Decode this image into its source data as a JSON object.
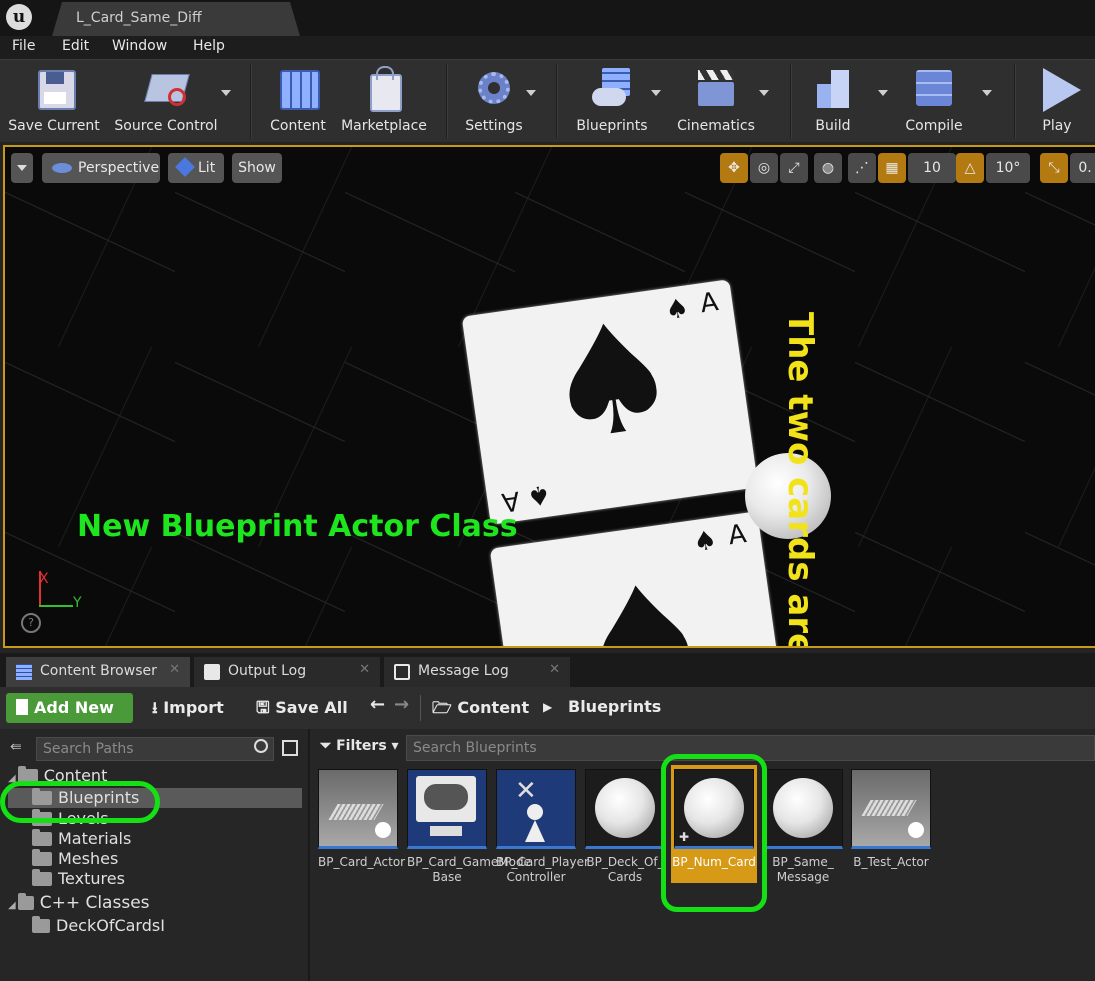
{
  "window": {
    "tab_title": "L_Card_Same_Diff",
    "logo_text": "u"
  },
  "menu": [
    "File",
    "Edit",
    "Window",
    "Help"
  ],
  "toolbar": {
    "save_current": "Save Current",
    "source_control": "Source Control",
    "content": "Content",
    "marketplace": "Marketplace",
    "settings": "Settings",
    "blueprints": "Blueprints",
    "cinematics": "Cinematics",
    "build": "Build",
    "compile": "Compile",
    "play": "Play"
  },
  "viewport": {
    "perspective": "Perspective",
    "lit": "Lit",
    "show": "Show",
    "grid_snap": "10",
    "rotation_snap": "10°",
    "scale_snap": "0.",
    "yellow_text": "The two cards are",
    "green_text": "New Blueprint Actor Class",
    "axis_x": "X",
    "axis_y": "Y",
    "card_rank": "A",
    "card_suit": "♠"
  },
  "panel_tabs": [
    "Content Browser",
    "Output Log",
    "Message Log"
  ],
  "content_browser": {
    "add_new": "Add New",
    "import": "Import",
    "save_all": "Save All",
    "path": [
      "Content",
      "Blueprints"
    ],
    "search_paths_placeholder": "Search Paths",
    "filters": "Filters",
    "search_placeholder": "Search Blueprints",
    "tree": {
      "content": "Content",
      "folders": [
        "Blueprints",
        "Levels",
        "Materials",
        "Meshes",
        "Textures"
      ],
      "cpp_classes": "C++ Classes",
      "cpp_folder": "DeckOfCardsI",
      "selected": "Blueprints"
    },
    "assets": [
      {
        "label": "BP_Card_Actor",
        "icon": "card-mesh-thumbnail"
      },
      {
        "label": "BP_Card_GameMode Base",
        "icon": "gamepad-monitor-thumbnail"
      },
      {
        "label": "BP_Card_Player Controller",
        "icon": "player-controller-thumbnail"
      },
      {
        "label": "BP_Deck_Of_ Cards",
        "icon": "sphere-thumbnail"
      },
      {
        "label": "BP_Num_Card",
        "icon": "sphere-thumbnail",
        "selected": true
      },
      {
        "label": "BP_Same_ Message",
        "icon": "sphere-thumbnail"
      },
      {
        "label": "B_Test_Actor",
        "icon": "card-mesh-thumbnail"
      }
    ]
  },
  "colors": {
    "highlight_ring": "#15e015",
    "selected_asset": "#d79a16",
    "add_new": "#4a9a3a"
  }
}
